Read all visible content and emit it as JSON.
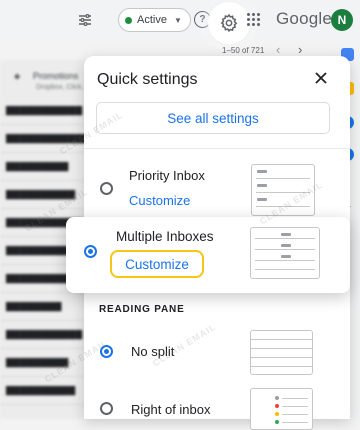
{
  "topbar": {
    "status_label": "Active",
    "brand": "Google",
    "avatar_initial": "N",
    "pager_text": "1–50 of 721"
  },
  "background_list": {
    "promotions_label": "Promotions",
    "promotions_sub": "Dropbox, Click..."
  },
  "quick_settings": {
    "title": "Quick settings",
    "see_all_label": "See all settings",
    "inbox_options": [
      {
        "label": "Priority Inbox",
        "link": "Customize",
        "selected": false
      },
      {
        "label": "Multiple Inboxes",
        "link": "Customize",
        "selected": true
      }
    ],
    "reading_pane_heading": "READING PANE",
    "reading_pane_options": [
      {
        "label": "No split",
        "selected": true
      },
      {
        "label": "Right of inbox",
        "selected": false
      }
    ]
  },
  "watermark": "CLEAN EMAIL",
  "colors": {
    "accent": "#1a73e8",
    "highlight_border": "#f5c518",
    "status_green": "#1e8e3e",
    "avatar": "#1b7e3f"
  }
}
